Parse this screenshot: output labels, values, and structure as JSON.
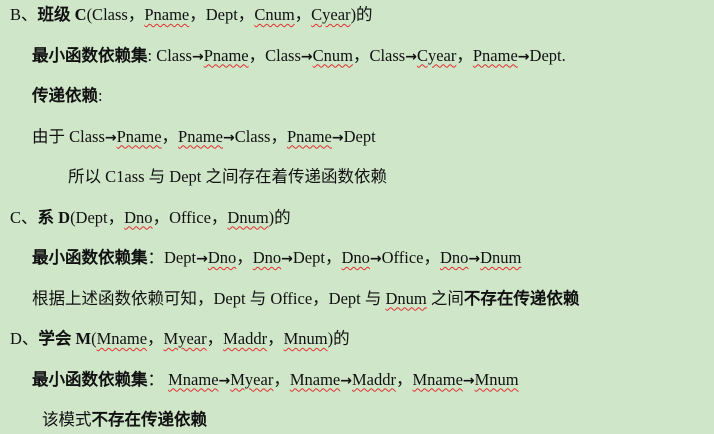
{
  "lines": [
    {
      "name": "section-b-heading",
      "segs": [
        {
          "t": "B、"
        },
        {
          "t": "班级 C",
          "b": 1
        },
        {
          "t": "(Class，"
        },
        {
          "t": "Pname",
          "u": 1
        },
        {
          "t": "，Dept，"
        },
        {
          "t": "Cnum",
          "u": 1
        },
        {
          "t": "，"
        },
        {
          "t": "Cyear",
          "u": 1
        },
        {
          "t": ")的"
        }
      ]
    },
    {
      "name": "section-b-min-fd",
      "segs": [
        {
          "t": "最小函数依赖集",
          "b": 1
        },
        {
          "t": ": Class"
        },
        {
          "t": "→",
          "a": 1
        },
        {
          "t": "Pname",
          "u": 1
        },
        {
          "t": "，Class"
        },
        {
          "t": "→",
          "a": 1
        },
        {
          "t": "Cnum",
          "u": 1
        },
        {
          "t": "，Class"
        },
        {
          "t": "→",
          "a": 1
        },
        {
          "t": "Cyear",
          "u": 1
        },
        {
          "t": "，"
        },
        {
          "t": "Pname",
          "u": 1
        },
        {
          "t": "→",
          "a": 1
        },
        {
          "t": "Dept."
        }
      ]
    },
    {
      "name": "section-b-transitive-label",
      "segs": [
        {
          "t": "传递依赖",
          "b": 1
        },
        {
          "t": ":"
        }
      ]
    },
    {
      "name": "section-b-because",
      "segs": [
        {
          "t": "由于 Class"
        },
        {
          "t": "→",
          "a": 1
        },
        {
          "t": "Pname",
          "u": 1
        },
        {
          "t": "，"
        },
        {
          "t": "Pname",
          "u": 1
        },
        {
          "t": "→",
          "a": 1
        },
        {
          "t": "Class，"
        },
        {
          "t": "Pname",
          "u": 1
        },
        {
          "t": "→",
          "a": 1
        },
        {
          "t": "Dept"
        }
      ]
    },
    {
      "name": "section-b-conclusion",
      "segs": [
        {
          "t": "所以 C1ass 与 Dept 之间存在着传递函数依赖"
        }
      ]
    },
    {
      "name": "section-c-heading",
      "segs": [
        {
          "t": "C、"
        },
        {
          "t": "系 D",
          "b": 1
        },
        {
          "t": "(Dept，"
        },
        {
          "t": "Dno",
          "u": 1
        },
        {
          "t": "，Office，"
        },
        {
          "t": "Dnum",
          "u": 1
        },
        {
          "t": ")的"
        }
      ]
    },
    {
      "name": "section-c-min-fd",
      "segs": [
        {
          "t": "最小函数依赖集",
          "b": 1
        },
        {
          "t": "：Dept"
        },
        {
          "t": "→",
          "a": 1
        },
        {
          "t": "Dno",
          "u": 1
        },
        {
          "t": "，"
        },
        {
          "t": "Dno",
          "u": 1
        },
        {
          "t": "→",
          "a": 1
        },
        {
          "t": "Dept，"
        },
        {
          "t": "Dno",
          "u": 1
        },
        {
          "t": "→",
          "a": 1
        },
        {
          "t": "Office，"
        },
        {
          "t": "Dno",
          "u": 1
        },
        {
          "t": "→",
          "a": 1
        },
        {
          "t": "Dnum",
          "u": 1
        }
      ]
    },
    {
      "name": "section-c-conclusion",
      "segs": [
        {
          "t": "根据上述函数依赖可知，Dept 与 Office，Dept 与 "
        },
        {
          "t": "Dnum",
          "u": 1
        },
        {
          "t": " 之间"
        },
        {
          "t": "不存在传递依赖",
          "b": 1
        }
      ]
    },
    {
      "name": "section-d-heading",
      "segs": [
        {
          "t": "D、"
        },
        {
          "t": "学会 M",
          "b": 1
        },
        {
          "t": "("
        },
        {
          "t": "Mname",
          "u": 1
        },
        {
          "t": "，"
        },
        {
          "t": "Myear",
          "u": 1
        },
        {
          "t": "，"
        },
        {
          "t": "Maddr",
          "u": 1
        },
        {
          "t": "，"
        },
        {
          "t": "Mnum",
          "u": 1
        },
        {
          "t": ")的"
        }
      ]
    },
    {
      "name": "section-d-min-fd",
      "segs": [
        {
          "t": "最小函数依赖集",
          "b": 1
        },
        {
          "t": "：  "
        },
        {
          "t": "Mname",
          "u": 1
        },
        {
          "t": "→",
          "a": 1
        },
        {
          "t": "Myear",
          "u": 1
        },
        {
          "t": "，"
        },
        {
          "t": "Mname",
          "u": 1
        },
        {
          "t": "→",
          "a": 1
        },
        {
          "t": "Maddr",
          "u": 1
        },
        {
          "t": "，"
        },
        {
          "t": "Mname",
          "u": 1
        },
        {
          "t": "→",
          "a": 1
        },
        {
          "t": "Mnum",
          "u": 1
        }
      ]
    },
    {
      "name": "section-d-conclusion",
      "segs": [
        {
          "t": "该模式"
        },
        {
          "t": "不存在传递依赖",
          "b": 1
        }
      ]
    }
  ]
}
